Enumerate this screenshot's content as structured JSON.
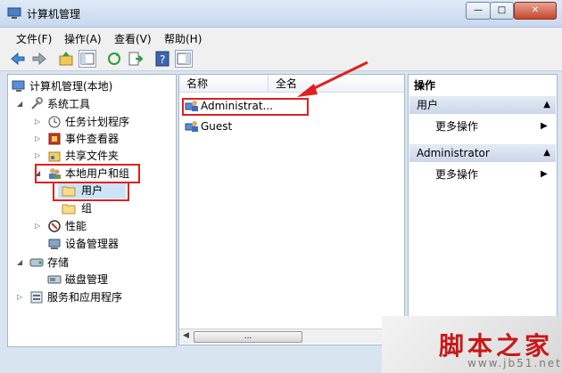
{
  "window": {
    "title": "计算机管理"
  },
  "menu": [
    "文件(F)",
    "操作(A)",
    "查看(V)",
    "帮助(H)"
  ],
  "tree": {
    "root": "计算机管理(本地)",
    "system_tools": "系统工具",
    "task_scheduler": "任务计划程序",
    "event_viewer": "事件查看器",
    "shared_folders": "共享文件夹",
    "local_users_groups": "本地用户和组",
    "users": "用户",
    "groups": "组",
    "performance": "性能",
    "device_manager": "设备管理器",
    "storage": "存储",
    "disk_management": "磁盘管理",
    "services_apps": "服务和应用程序"
  },
  "list": {
    "col_name": "名称",
    "col_fullname": "全名",
    "items": [
      "Administrat...",
      "Guest"
    ],
    "scroll_label": "..."
  },
  "actions": {
    "title": "操作",
    "group1": "用户",
    "group1_item": "更多操作",
    "group2": "Administrator",
    "group2_item": "更多操作"
  },
  "watermark": {
    "site_cn": "脚本之家",
    "url": "www.jb51.net"
  },
  "colors": {
    "highlight": "#e02020",
    "watermark_red": "#c81818"
  }
}
